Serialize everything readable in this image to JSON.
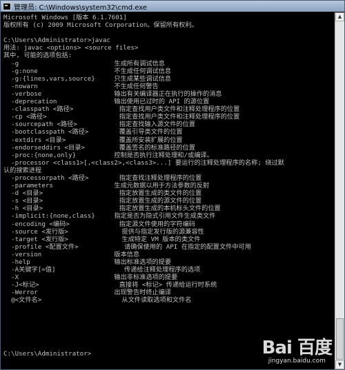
{
  "window": {
    "title": "管理员: C:\\Windows\\system32\\cmd.exe"
  },
  "console": {
    "lines": [
      "Microsoft Windows [版本 6.1.7601]",
      "版权所有 (c) 2009 Microsoft Corporation。保留所有权利。",
      "",
      "C:\\Users\\Administrator>javac",
      "用法: javac <options> <source files>",
      "其中, 可能的选项包括:",
      "  -g                         生成所有调试信息",
      "  -g:none                    不生成任何调试信息",
      "  -g:{lines,vars,source}     只生成某些调试信息",
      "  -nowarn                    不生成任何警告",
      "  -verbose                   输出有关编译器正在执行的操作的消息",
      "  -deprecation               输出使用已过时的 API 的源位置",
      "  -classpath <路径>            指定查找用户类文件和注释处理程序的位置",
      "  -cp <路径>                   指定查找用户类文件和注释处理程序的位置",
      "  -sourcepath <路径>           指定查找输入源文件的位置",
      "  -bootclasspath <路径>        覆盖引导类文件的位置",
      "  -extdirs <目录>              覆盖所安装扩展的位置",
      "  -endorseddirs <目录>         覆盖签名的标准路径的位置",
      "  -proc:{none,only}          控制是否执行注释处理和/或编译。",
      "  -processor <class1>[,<class2>,<class3>...] 要运行的注释处理程序的名称; 绕过默",
      "认的搜索进程",
      "  -processorpath <路径>        指定查找注释处理程序的位置",
      "  -parameters                生成元数据以用于方法参数的反射",
      "  -d <目录>                    指定放置生成的类文件的位置",
      "  -s <目录>                    指定放置生成的源文件的位置",
      "  -h <目录>                    指定放置生成的本机标头文件的位置",
      "  -implicit:{none,class}     指定是否为隐式引用文件生成类文件",
      "  -encoding <编码>             指定源文件使用的字符编码",
      "  -source <发行版>              提供与指定发行版的源兼容性",
      "  -target <发行版>              生成特定 VM 版本的类文件",
      "  -profile <配置文件>            请确保使用的 API 在指定的配置文件中可用",
      "  -version                   版本信息",
      "  -help                      输出标准选项的提要",
      "  -A关键字[=值]                  传递给注释处理程序的选项",
      "  -X                         输出非标准选项的提要",
      "  -J<标记>                     直接将 <标记> 传递给运行时系统",
      "  -Werror                    出现警告时终止编译",
      "  @<文件名>                     从文件读取选项和文件名",
      "",
      "",
      "",
      "",
      "",
      "",
      "C:\\Users\\Administrator>"
    ]
  },
  "watermark": {
    "logo": "Bai 百度",
    "url": "jingyan.baidu.com"
  }
}
